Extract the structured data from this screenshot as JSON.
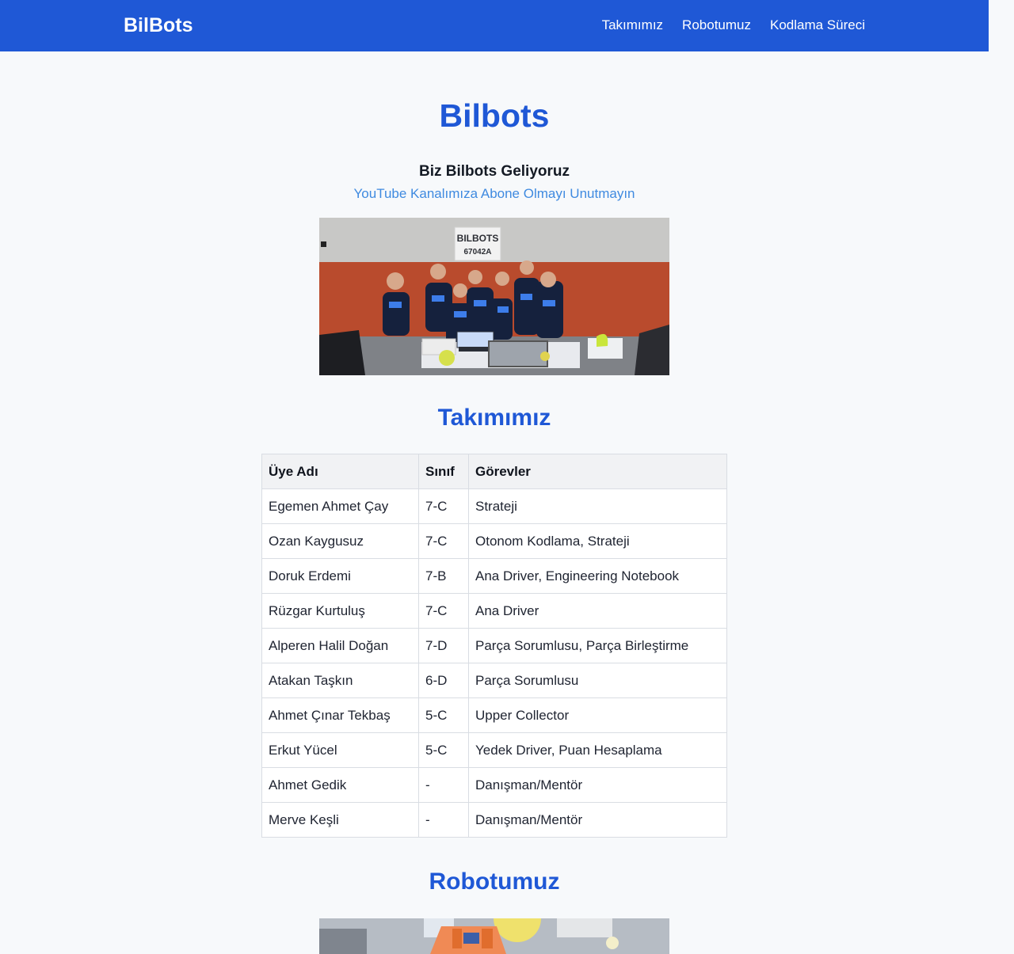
{
  "brand": "BilBots",
  "nav": [
    "Takımımız",
    "Robotumuz",
    "Kodlama Süreci"
  ],
  "hero": {
    "title": "Bilbots",
    "subtitle": "Biz Bilbots Geliyoruz",
    "youtube_link": "YouTube Kanalımıza Abone Olmayı Unutmayın"
  },
  "team_photo": {
    "banner_text": "BILBOTS",
    "team_number": "67042A"
  },
  "team_section": {
    "title": "Takımımız",
    "headers": [
      "Üye Adı",
      "Sınıf",
      "Görevler"
    ],
    "rows": [
      [
        "Egemen Ahmet Çay",
        "7-C",
        "Strateji"
      ],
      [
        "Ozan Kaygusuz",
        "7-C",
        "Otonom Kodlama, Strateji"
      ],
      [
        "Doruk Erdemi",
        "7-B",
        "Ana Driver, Engineering Notebook"
      ],
      [
        "Rüzgar Kurtuluş",
        "7-C",
        "Ana Driver"
      ],
      [
        "Alperen Halil Doğan",
        "7-D",
        "Parça Sorumlusu, Parça Birleştirme"
      ],
      [
        "Atakan Taşkın",
        "6-D",
        "Parça Sorumlusu"
      ],
      [
        "Ahmet Çınar Tekbaş",
        "5-C",
        "Upper Collector"
      ],
      [
        "Erkut Yücel",
        "5-C",
        "Yedek Driver, Puan Hesaplama"
      ],
      [
        "Ahmet Gedik",
        "-",
        "Danışman/Mentör"
      ],
      [
        "Merve Keşli",
        "-",
        "Danışman/Mentör"
      ]
    ]
  },
  "robot_section": {
    "title": "Robotumuz"
  },
  "colors": {
    "nav_background": "#1f58d6",
    "heading_blue": "#1f58d6",
    "link_blue": "#3f8ae0",
    "page_background": "#f7f9fb"
  }
}
